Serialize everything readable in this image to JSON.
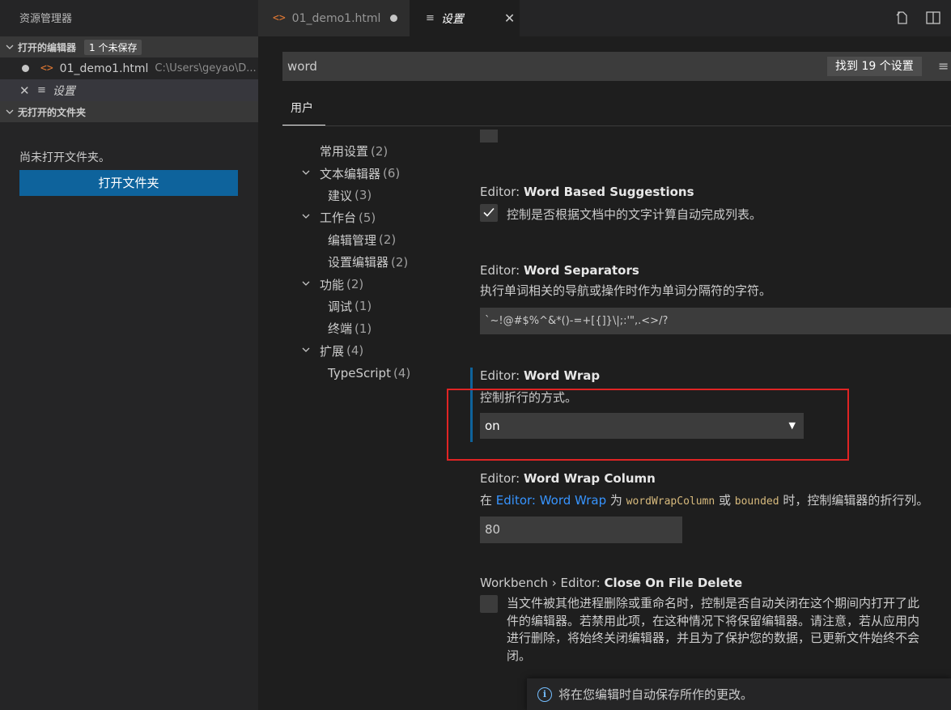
{
  "sidebar": {
    "title": "资源管理器",
    "open_editors": {
      "header": "打开的编辑器",
      "badge": "1 个未保存",
      "items": [
        {
          "name": "01_demo1.html",
          "path": "C:\\Users\\geyao\\D...",
          "icon": "html-file-icon",
          "dirty": true
        },
        {
          "name": "设置",
          "icon": "settings-lines-icon",
          "active": true
        }
      ]
    },
    "no_folder": {
      "header": "无打开的文件夹",
      "message": "尚未打开文件夹。",
      "button": "打开文件夹"
    }
  },
  "tabs": [
    {
      "label": "01_demo1.html",
      "icon": "html-file-icon",
      "dirty": true
    },
    {
      "label": "设置",
      "icon": "settings-lines-icon",
      "active": true
    }
  ],
  "settings": {
    "search_value": "word",
    "found_label": "找到 19 个设置",
    "scope_tab": "用户",
    "toc": [
      {
        "label": "常用设置",
        "count": "(2)",
        "level": 1
      },
      {
        "label": "文本编辑器",
        "count": "(6)",
        "level": 0,
        "expanded": true
      },
      {
        "label": "建议",
        "count": "(3)",
        "level": 2
      },
      {
        "label": "工作台",
        "count": "(5)",
        "level": 0,
        "expanded": true
      },
      {
        "label": "编辑管理",
        "count": "(2)",
        "level": 2
      },
      {
        "label": "设置编辑器",
        "count": "(2)",
        "level": 2
      },
      {
        "label": "功能",
        "count": "(2)",
        "level": 0,
        "expanded": true
      },
      {
        "label": "调试",
        "count": "(1)",
        "level": 2
      },
      {
        "label": "终端",
        "count": "(1)",
        "level": 2
      },
      {
        "label": "扩展",
        "count": "(4)",
        "level": 0,
        "expanded": true
      },
      {
        "label": "TypeScript",
        "count": "(4)",
        "level": 2
      }
    ],
    "items": {
      "word_based": {
        "category": "Editor: ",
        "name": "Word Based Suggestions",
        "desc": "控制是否根据文档中的文字计算自动完成列表。",
        "checked": true
      },
      "word_separators": {
        "category": "Editor: ",
        "name": "Word Separators",
        "desc": "执行单词相关的导航或操作时作为单词分隔符的字符。",
        "value": "`~!@#$%^&*()-=+[{]}\\|;:'\",.<>/?"
      },
      "word_wrap": {
        "category": "Editor: ",
        "name": "Word Wrap",
        "desc": "控制折行的方式。",
        "value": "on"
      },
      "word_wrap_column": {
        "category": "Editor: ",
        "name": "Word Wrap Column",
        "desc_prefix": "在 ",
        "desc_link": "Editor: Word Wrap",
        "desc_mid1": " 为 ",
        "desc_code1": "wordWrapColumn",
        "desc_mid2": " 或 ",
        "desc_code2": "bounded",
        "desc_suffix": " 时，控制编辑器的折行列。",
        "value": "80"
      },
      "close_on_delete": {
        "category": "Workbench › Editor: ",
        "name": "Close On File Delete",
        "desc_lines": [
          "当文件被其他进程删除或重命名时，控制是否自动关闭在这个期间内打开了此",
          "件的编辑器。若禁用此项，在这种情况下将保留编辑器。请注意，若从应用内",
          "进行删除，将始终关闭编辑器，并且为了保护您的数据，已更新文件始终不会",
          "闭。"
        ],
        "checked": false
      }
    }
  },
  "notification": {
    "text": "将在您编辑时自动保存所作的更改。",
    "icon": "info-icon"
  },
  "colors": {
    "accent": "#0e639c",
    "highlight_box": "#e02424",
    "link": "#3794ff"
  }
}
